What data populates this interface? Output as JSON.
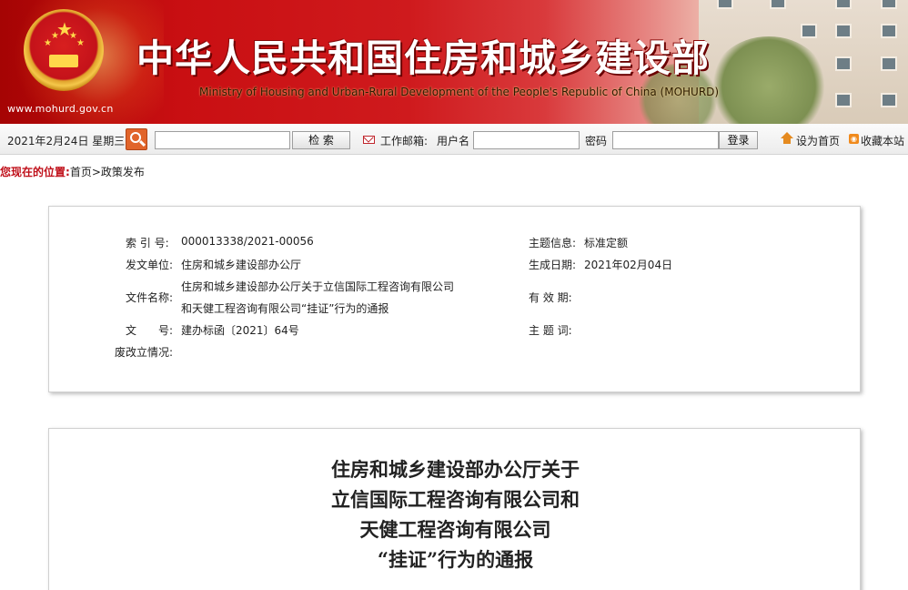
{
  "banner": {
    "site_url": "www.mohurd.gov.cn",
    "title_cn": "中华人民共和国住房和城乡建设部",
    "title_en": "Ministry of Housing and Urban-Rural Development of the People's Republic of China (MOHURD)",
    "colors": {
      "primary": "#c90f12",
      "title": "#ffffff"
    }
  },
  "toolbar": {
    "date": "2021年2月24日  星期三",
    "search": {
      "value": "",
      "button": "检   索"
    },
    "mail": {
      "label": "工作邮箱:",
      "username_label": "用户名",
      "username_value": "",
      "password_label": "密码",
      "password_value": "",
      "login_button": "登录"
    },
    "set_home": "设为首页",
    "bookmark": "收藏本站"
  },
  "breadcrumb": {
    "prefix": "您现在的位置:",
    "path": "首页>政策发布"
  },
  "info": {
    "index_label": "索 引 号:",
    "index_value": "000013338/2021-00056",
    "issuer_label": "发文单位:",
    "issuer_value": "住房和城乡建设部办公厅",
    "filename_label": "文件名称:",
    "filename_line1": "住房和城乡建设部办公厅关于立信国际工程咨询有限公司",
    "filename_line2": "和天健工程咨询有限公司“挂证”行为的通报",
    "docno_label": "文　　号:",
    "docno_value": "建办标函〔2021〕64号",
    "status_label": "废改立情况:",
    "status_value": "",
    "topic_label": "主题信息:",
    "topic_value": "标准定额",
    "date_label": "生成日期:",
    "date_value": "2021年02月04日",
    "validity_label": "有 效 期:",
    "validity_value": "",
    "keywords_label": "主 题 词:",
    "keywords_value": ""
  },
  "article": {
    "title_lines": [
      "住房和城乡建设部办公厅关于",
      "立信国际工程咨询有限公司和",
      "天健工程咨询有限公司",
      "“挂证”行为的通报"
    ]
  }
}
